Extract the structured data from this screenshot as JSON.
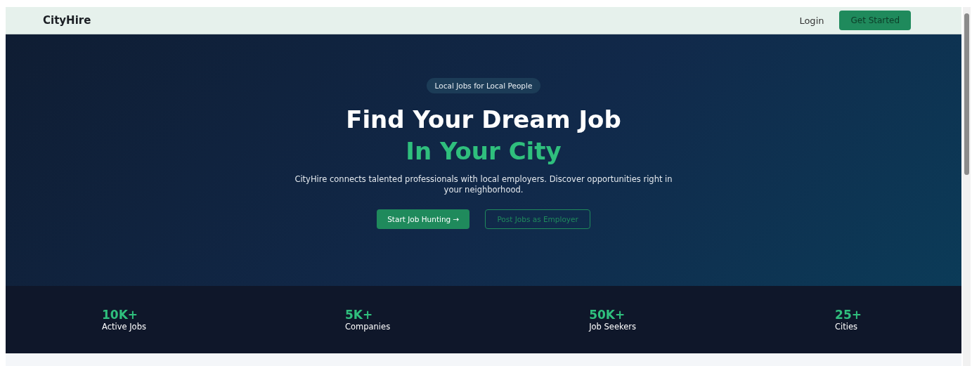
{
  "nav": {
    "brand": "CityHire",
    "login": "Login",
    "cta": "Get Started"
  },
  "hero": {
    "badge": "Local Jobs for Local People",
    "title": "Find Your Dream Job",
    "highlight": "In Your City",
    "description": "CityHire connects talented professionals with local employers. Discover opportunities right in your neighborhood.",
    "primary_button": "Start Job Hunting →",
    "secondary_button": "Post Jobs as Employer"
  },
  "stats": [
    {
      "value": "10K+",
      "label": "Active Jobs"
    },
    {
      "value": "5K+",
      "label": "Companies"
    },
    {
      "value": "50K+",
      "label": "Job Seekers"
    },
    {
      "value": "25+",
      "label": "Cities"
    }
  ]
}
